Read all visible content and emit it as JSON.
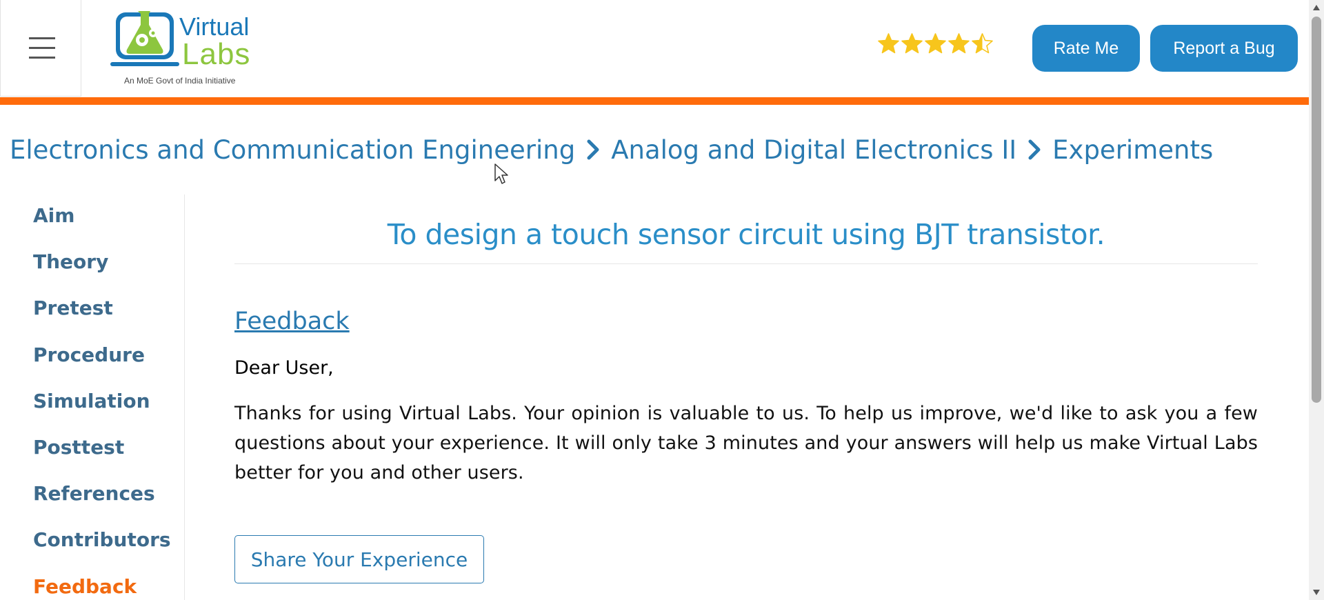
{
  "header": {
    "logo": {
      "brand_top": "Virtual",
      "brand_bottom": "Labs",
      "tagline": "An MoE Govt of India Initiative"
    },
    "rating": {
      "stars": 4.5,
      "max": 5,
      "color": "#f7c51c"
    },
    "rate_button": "Rate Me",
    "bug_button": "Report a Bug",
    "accent_color": "#ff6b0b",
    "button_color": "#2387c8"
  },
  "breadcrumb": {
    "items": [
      "Electronics and Communication Engineering",
      "Analog and Digital Electronics II",
      "Experiments"
    ]
  },
  "sidebar": {
    "items": [
      {
        "label": "Aim"
      },
      {
        "label": "Theory"
      },
      {
        "label": "Pretest"
      },
      {
        "label": "Procedure"
      },
      {
        "label": "Simulation"
      },
      {
        "label": "Posttest"
      },
      {
        "label": "References"
      },
      {
        "label": "Contributors"
      },
      {
        "label": "Feedback",
        "active": true
      }
    ]
  },
  "main": {
    "title": "To design a touch sensor circuit using BJT transistor.",
    "section_heading": "Feedback",
    "greeting_name": "Dear User",
    "greeting_punct": ",",
    "paragraph": "Thanks for using Virtual Labs. Your opinion is valuable to us. To help us improve, we'd like to ask you a few questions about your experience. It will only take 3 minutes and your answers will help us make Virtual Labs better for you and other users.",
    "share_button": "Share Your Experience"
  }
}
